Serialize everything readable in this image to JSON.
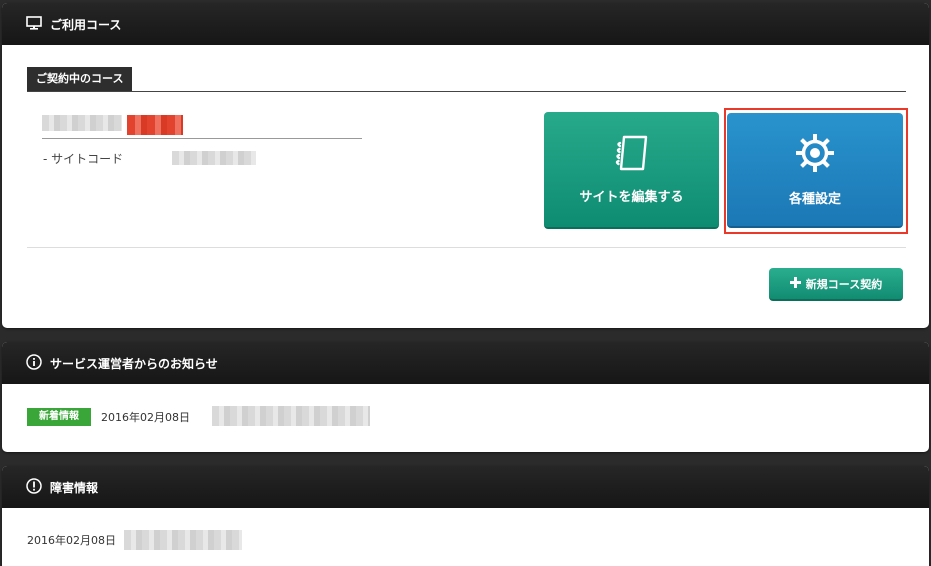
{
  "course_panel": {
    "title": "ご利用コース",
    "contract_tab": "ご契約中のコース",
    "site_code_label": "- サイトコード",
    "edit_site_button": "サイトを編集する",
    "settings_button": "各種設定",
    "new_course_button": "新規コース契約"
  },
  "notice_panel": {
    "title": "サービス運営者からのお知らせ",
    "badge": "新着情報",
    "date": "2016年02月08日"
  },
  "trouble_panel": {
    "title": "障害情報",
    "date": "2016年02月08日"
  },
  "colors": {
    "header": "#1e1e1e",
    "teal": "#17a283",
    "blue": "#2189c4",
    "highlight": "#e8392b",
    "badge_green": "#3aa63a"
  }
}
